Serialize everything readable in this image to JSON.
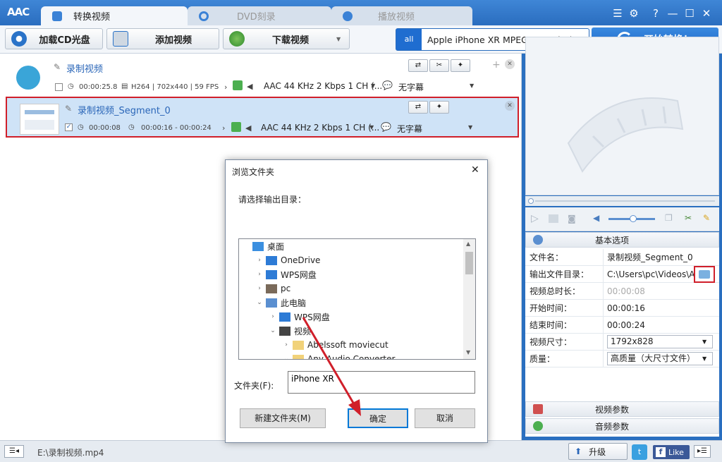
{
  "app": {
    "logo": "AAC"
  },
  "tabs": [
    {
      "label": "转换视频"
    },
    {
      "label": "DVD刻录"
    },
    {
      "label": "播放视频"
    }
  ],
  "window_controls": {
    "list": "☰",
    "settings": "⚙",
    "help": "?",
    "minimize": "—",
    "maximize": "☐",
    "close": "✕"
  },
  "toolbar": {
    "load_cd": "加载CD光盘",
    "add_video": "添加视频",
    "download_video": "下载视频",
    "dropdown_arrow": "▼"
  },
  "profile": {
    "icon_text": "all",
    "label": "Apple iPhone XR MPEG-4 Movie (*.m...",
    "arrow": "▼"
  },
  "start": {
    "label": "开始转换！"
  },
  "files": [
    {
      "name": "录制视频",
      "duration": "00:00:25.8",
      "codec": "H264 | 702x440 | 59 FPS",
      "audio": "AAC 44 KHz 2 Kbps 1 CH (...",
      "subtitle": "无字幕",
      "checked": false
    },
    {
      "name": "录制视频_Segment_0",
      "duration": "00:00:08",
      "range": "00:00:16 - 00:00:24",
      "audio": "AAC 44 KHz 2 Kbps 1 CH (...",
      "subtitle": "无字幕",
      "checked": true
    }
  ],
  "props": {
    "basic_header": "基本选项",
    "rows": [
      {
        "label": "文件名：",
        "value": "录制视频_Segment_0"
      },
      {
        "label": "输出文件目录：",
        "value": "C:\\Users\\pc\\Videos\\An..."
      },
      {
        "label": "视频总时长：",
        "value": "00:00:08"
      },
      {
        "label": "开始时间：",
        "value": "00:00:16"
      },
      {
        "label": "结束时间：",
        "value": "00:00:24"
      },
      {
        "label": "视频尺寸：",
        "value": "1792x828"
      },
      {
        "label": "质量：",
        "value": "高质量（大尺寸文件）"
      }
    ],
    "video_params": "视频参数",
    "audio_params": "音频参数"
  },
  "status": {
    "path": "E:\\录制视频.mp4",
    "upgrade": "升级",
    "like": "Like"
  },
  "dialog": {
    "title": "浏览文件夹",
    "prompt": "请选择输出目录：",
    "tree": [
      {
        "label": "桌面",
        "indent": 0,
        "expander": "",
        "icon": "#3b8fe0"
      },
      {
        "label": "OneDrive",
        "indent": 1,
        "expander": "›",
        "icon": "#2d7bd6"
      },
      {
        "label": "WPS网盘",
        "indent": 1,
        "expander": "›",
        "icon": "#2d7bd6"
      },
      {
        "label": "pc",
        "indent": 1,
        "expander": "›",
        "icon": "#7a6a5a"
      },
      {
        "label": "此电脑",
        "indent": 1,
        "expander": "⌄",
        "icon": "#5a8fd0"
      },
      {
        "label": "WPS网盘",
        "indent": 2,
        "expander": "›",
        "icon": "#2d7bd6"
      },
      {
        "label": "视频",
        "indent": 2,
        "expander": "⌄",
        "icon": "#444444"
      },
      {
        "label": "Abelssoft moviecut",
        "indent": 3,
        "expander": "›",
        "icon": "#f1d27a"
      },
      {
        "label": "Any Audio Converter",
        "indent": 3,
        "expander": "⌄",
        "icon": "#f1d27a"
      }
    ],
    "folder_label": "文件夹(F):",
    "folder_value": "iPhone XR",
    "new_folder": "新建文件夹(M)",
    "ok": "确定",
    "cancel": "取消",
    "close": "✕"
  }
}
